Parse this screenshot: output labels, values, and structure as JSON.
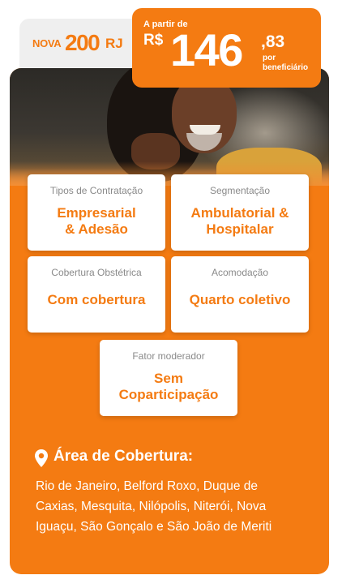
{
  "brand": {
    "prefix": "NOVA",
    "number": "200",
    "suffix": "RJ"
  },
  "price": {
    "from_label": "A partir de",
    "currency": "R$",
    "integer": "146",
    "cents": ",83",
    "per_line1": "por",
    "per_line2": "beneficiário"
  },
  "photo": {
    "description_icon": "smiling-man-hug-image"
  },
  "features": [
    {
      "label": "Tipos de Contratação",
      "value_line1": "Empresarial",
      "value_line2": "& Adesão"
    },
    {
      "label": "Segmentação",
      "value_line1": "Ambulatorial &",
      "value_line2": "Hospitalar"
    },
    {
      "label": "Cobertura Obstétrica",
      "value_line1": "Com cobertura",
      "value_line2": ""
    },
    {
      "label": "Acomodação",
      "value_line1": "Quarto coletivo",
      "value_line2": ""
    },
    {
      "label": "Fator moderador",
      "value_line1": "Sem",
      "value_line2": "Coparticipação"
    }
  ],
  "coverage": {
    "icon": "map-pin-icon",
    "title": "Área de Cobertura:",
    "line1": "Rio de Janeiro, Belford Roxo, Duque de",
    "line2": "Caxias, Mesquita, Nilópolis, Niterói, Nova",
    "line3": "Iguaçu, São Gonçalo e São João de Meriti"
  },
  "colors": {
    "accent": "#f47b12",
    "text_on_accent": "#ffffff",
    "label_gray": "#8a8a8a"
  }
}
